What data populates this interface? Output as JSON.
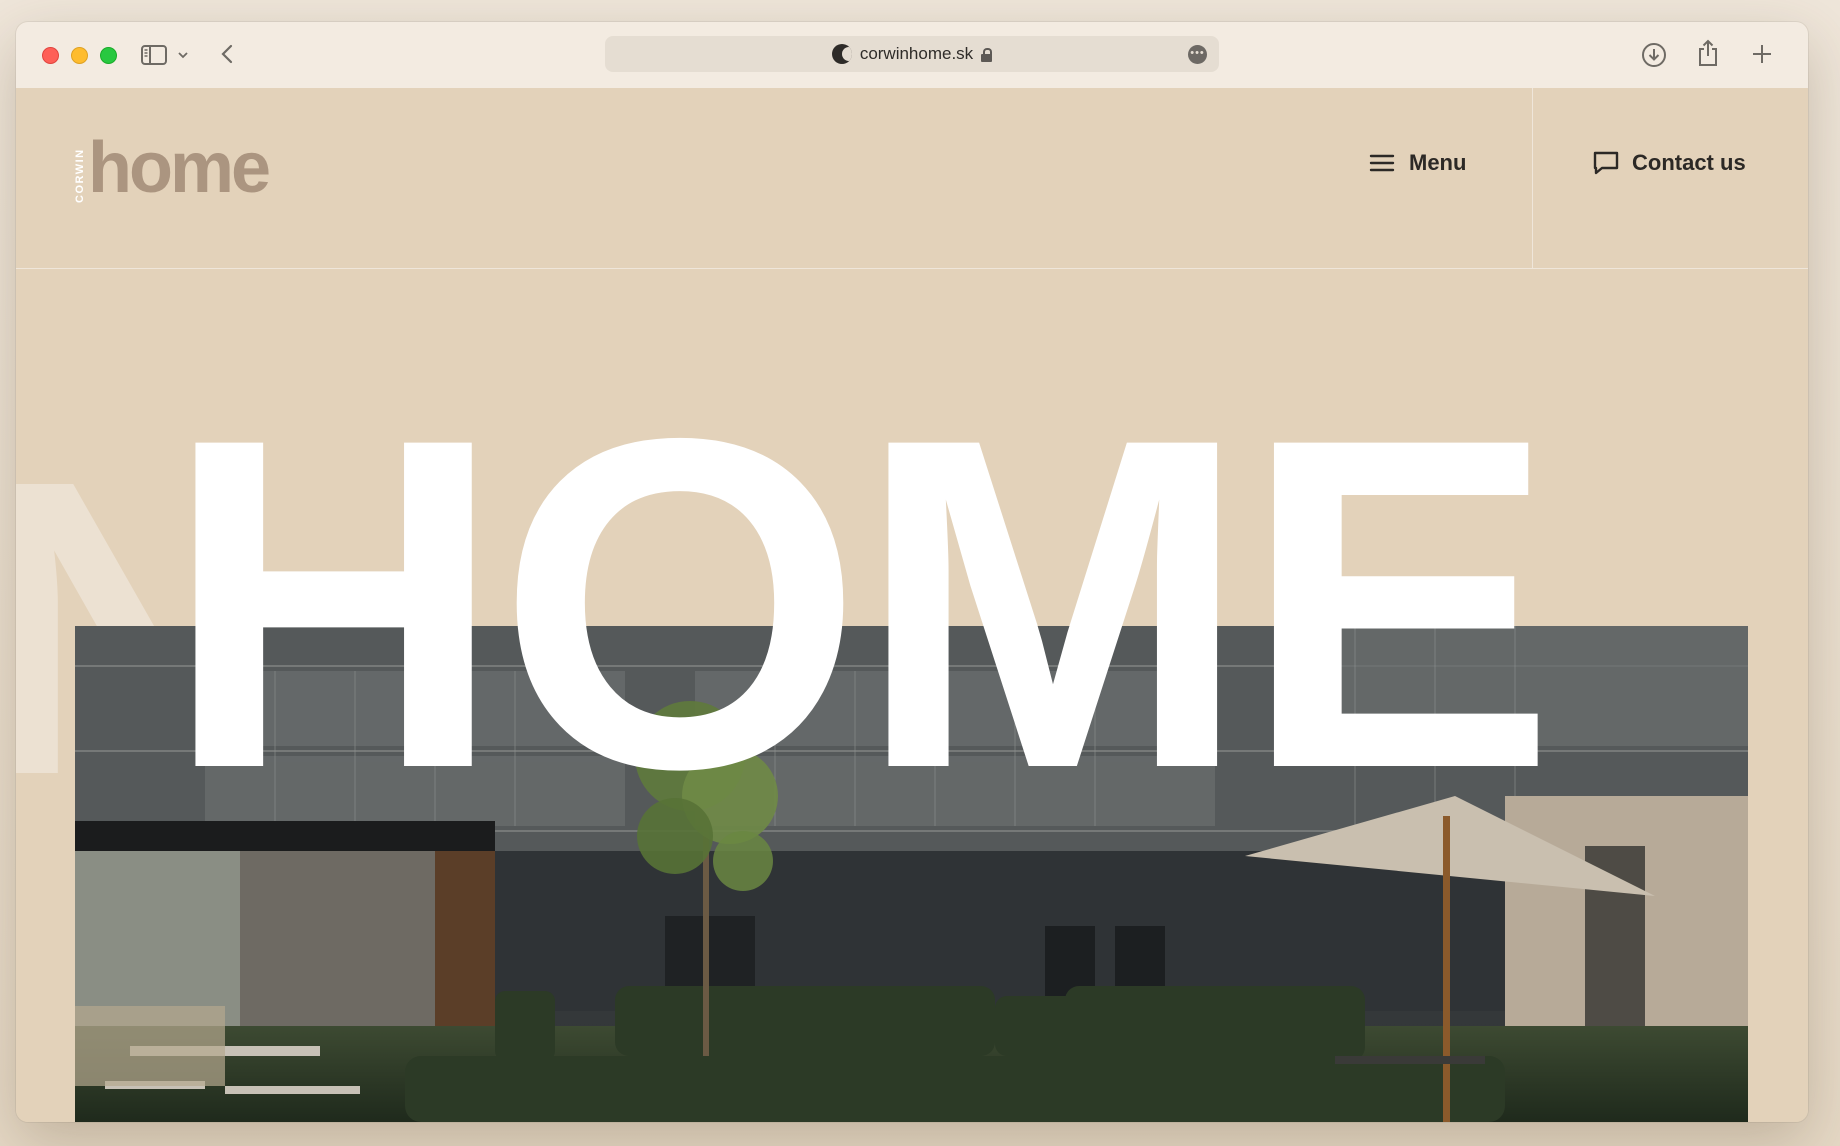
{
  "browser": {
    "url": "corwinhome.sk"
  },
  "site": {
    "logo_small": "CORWIN",
    "logo_main": "home",
    "menu_label": "Menu",
    "contact_label": "Contact us"
  },
  "hero": {
    "headline": "HOME"
  }
}
